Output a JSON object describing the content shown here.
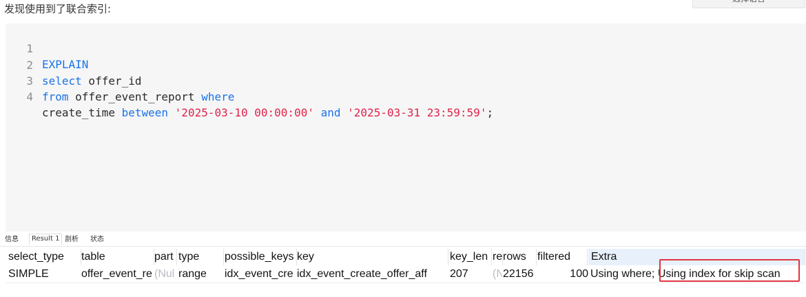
{
  "intro_text": "发现使用到了联合索引:",
  "language_button": "选择语言",
  "editor": {
    "lines": [
      {
        "num": "1",
        "tokens": [
          "EXPLAIN"
        ]
      },
      {
        "num": "2",
        "tokens": [
          "select",
          " offer_id"
        ]
      },
      {
        "num": "3",
        "tokens": [
          "from",
          " offer_event_report ",
          "where"
        ]
      },
      {
        "num": "4",
        "tokens": [
          "create_time ",
          "between",
          " ",
          "'2025-03-10 00:00:00'",
          " ",
          "and",
          " ",
          "'2025-03-31 23:59:59'",
          ";"
        ]
      }
    ]
  },
  "tabs": [
    "信息",
    "Result 1",
    "剖析",
    "状态"
  ],
  "result": {
    "headers": [
      "select_type",
      "table",
      "part",
      "type",
      "possible_keys",
      "key",
      "key_len",
      "re",
      "rows",
      "filtered",
      "Extra"
    ],
    "row": [
      "SIMPLE",
      "offer_event_re",
      "(Nul",
      "range",
      "idx_event_cre",
      "idx_event_create_offer_aff",
      "207",
      "(N",
      "22156",
      "100",
      "Using where; Using index for skip scan"
    ]
  },
  "colors": {
    "keyword": "#1a73e8",
    "string": "#e0224a",
    "highlight_border": "#e0343f",
    "null_text": "#b8bcc6"
  }
}
